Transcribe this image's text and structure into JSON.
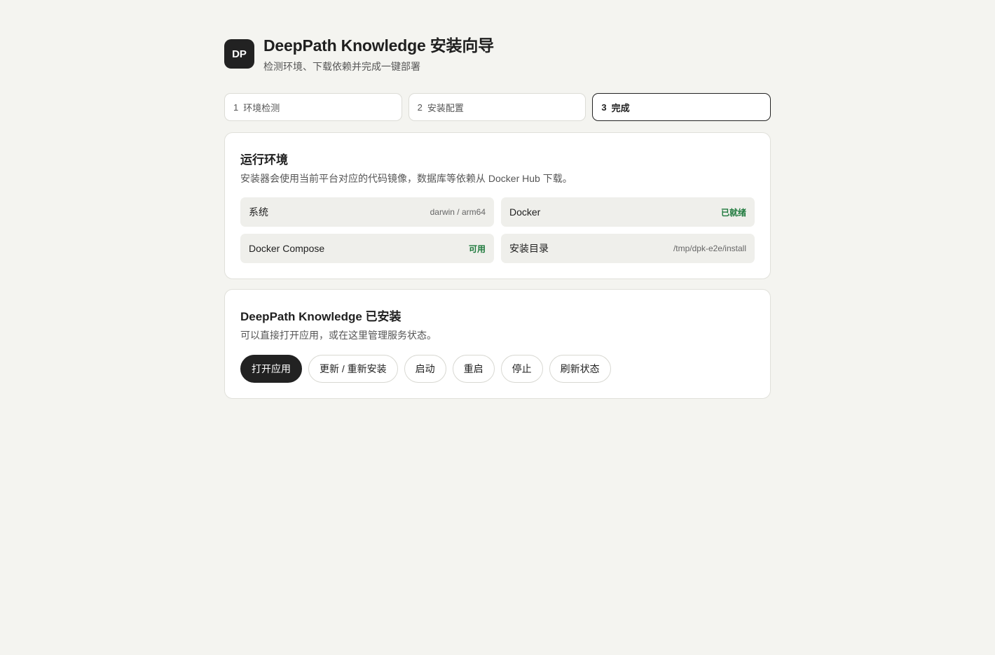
{
  "header": {
    "logo_text": "DP",
    "title": "DeepPath Knowledge 安装向导",
    "subtitle": "检测环境、下载依赖并完成一键部署"
  },
  "steps": [
    {
      "num": "1",
      "label": "环境检测",
      "active": false
    },
    {
      "num": "2",
      "label": "安装配置",
      "active": false
    },
    {
      "num": "3",
      "label": "完成",
      "active": true
    }
  ],
  "environment": {
    "title": "运行环境",
    "description": "安装器会使用当前平台对应的代码镜像，数据库等依赖从 Docker Hub 下载。",
    "items": [
      {
        "label": "系统",
        "value": "darwin / arm64",
        "status": "info"
      },
      {
        "label": "Docker",
        "value": "已就绪",
        "status": "ok"
      },
      {
        "label": "Docker Compose",
        "value": "可用",
        "status": "ok"
      },
      {
        "label": "安装目录",
        "value": "/tmp/dpk-e2e/install",
        "status": "info"
      }
    ]
  },
  "installed": {
    "title": "DeepPath Knowledge 已安装",
    "description": "可以直接打开应用，或在这里管理服务状态。",
    "buttons": {
      "open": "打开应用",
      "reinstall": "更新 / 重新安装",
      "start": "启动",
      "restart": "重启",
      "stop": "停止",
      "refresh": "刷新状态"
    }
  },
  "colors": {
    "background": "#f4f4f0",
    "primary": "#222222",
    "success": "#1f7a3d"
  }
}
